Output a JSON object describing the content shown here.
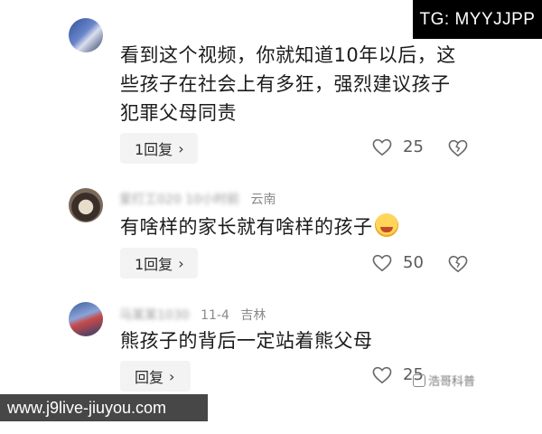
{
  "overlays": {
    "tg_badge": "TG: MYYJJPP",
    "watermark_url": "www.j9live-jiuyou.com",
    "source_tag": "浩哥科普"
  },
  "comments": [
    {
      "text_lines": [
        "看到这个视频，你就知道10年以后，这",
        "些孩子在社会上有多狂，强烈建议孩子",
        "犯罪父母同责"
      ],
      "reply_label": "1回复",
      "likes": "25"
    },
    {
      "meta_blurred": "爱打工020",
      "meta_time": "10小时前",
      "location": "云南",
      "text": "有啥样的家长就有啥样的孩子",
      "reply_label": "1回复",
      "likes": "50"
    },
    {
      "meta_blurred": "马某某1030",
      "meta_time": "11-4",
      "location": "吉林",
      "text": "熊孩子的背后一定站着熊父母",
      "reply_label": "回复",
      "likes": "25"
    }
  ],
  "icons": {
    "chevron": "›",
    "like": "heart-icon",
    "dislike": "broken-heart-icon",
    "emoji": "laughing-emoji-icon"
  }
}
